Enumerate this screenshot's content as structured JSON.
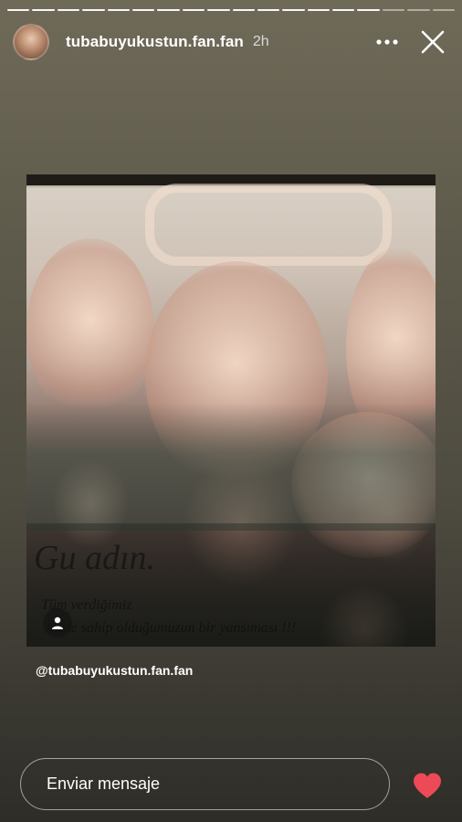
{
  "story": {
    "segments_total": 18,
    "segments_done": 15,
    "author": "tubabuyukustun.fan.fan",
    "time_ago": "2h",
    "mention": "@tubabuyukustun.fan.fan"
  },
  "photo": {
    "script_text": "Gu      adın.",
    "quote_line_1": "Tüm verdiğimiz",
    "quote_line_2": "  nizde sahip olduğumuzun bir yansıması !!!"
  },
  "reply": {
    "placeholder": "Enviar mensaje"
  },
  "icons": {
    "more": "more-horizontal-icon",
    "close": "close-icon",
    "tag": "user-tag-icon",
    "like": "heart-icon"
  },
  "colors": {
    "heart": "#ed4956"
  }
}
